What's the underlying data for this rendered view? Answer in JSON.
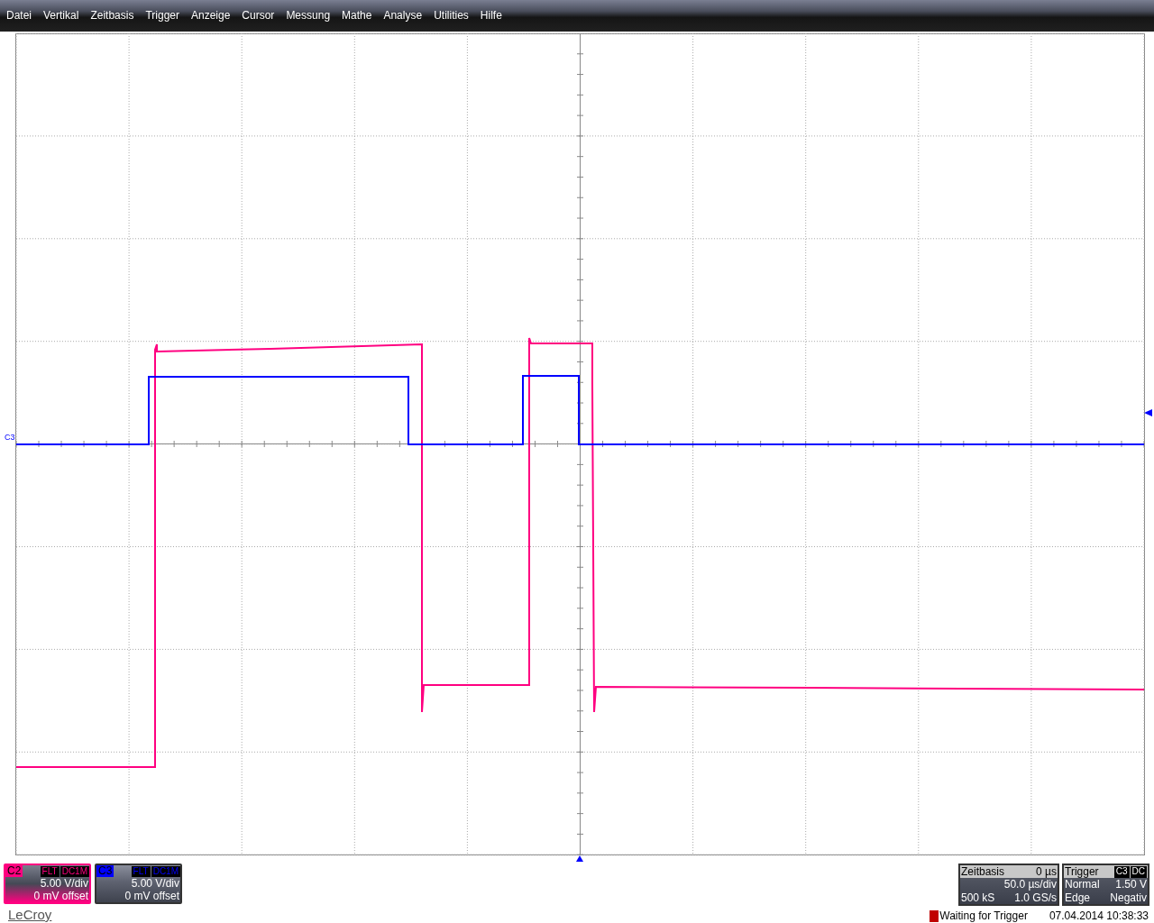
{
  "menu_bar": {
    "items": [
      "Datei",
      "Vertikal",
      "Zeitbasis",
      "Trigger",
      "Anzeige",
      "Cursor",
      "Messung",
      "Mathe",
      "Analyse",
      "Utilities",
      "Hilfe"
    ]
  },
  "plot": {
    "ground_marker": "C3"
  },
  "channels": [
    {
      "label": "C2",
      "color": "#ff0080",
      "filter": "FLT",
      "coupling": "DC1M",
      "scale": "5.00 V/div",
      "offset": "0 mV offset"
    },
    {
      "label": "C3",
      "color": "#0000ff",
      "filter": "FLT",
      "coupling": "DC1M",
      "scale": "5.00 V/div",
      "offset": "0 mV offset"
    }
  ],
  "logo": "LeCroy",
  "timebase": {
    "title": "Zeitbasis",
    "delay": "0 µs",
    "scale": "50.0 µs/div",
    "samples": "500 kS",
    "rate": "1.0 GS/s"
  },
  "trigger": {
    "title": "Trigger",
    "source": "C3",
    "coupling": "DC",
    "mode": "Normal",
    "level": "1.50 V",
    "type": "Edge",
    "slope": "Negativ"
  },
  "status": {
    "message": "Waiting for Trigger",
    "datetime": "07.04.2014 10:38:33"
  }
}
